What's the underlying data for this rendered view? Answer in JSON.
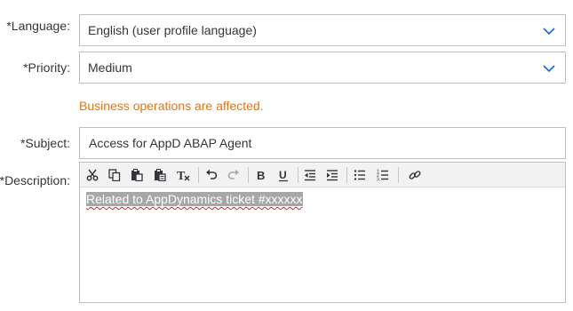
{
  "form": {
    "language_label": "*Language:",
    "language_value": "English (user profile language)",
    "priority_label": "*Priority:",
    "priority_value": "Medium",
    "priority_hint": "Business operations are affected.",
    "subject_label": "*Subject:",
    "subject_value": "Access for AppD ABAP Agent",
    "description_label": "*Description:",
    "description_value": "Related to AppDynamics ticket #xxxxxx"
  },
  "toolbar": {
    "buttons": [
      "cut-icon",
      "copy-icon",
      "paste-icon",
      "paste-as-text-icon",
      "remove-format-icon",
      "undo-icon",
      "redo-icon",
      "bold-icon",
      "underline-icon",
      "outdent-icon",
      "indent-icon",
      "bulleted-list-icon",
      "numbered-list-icon",
      "link-icon"
    ]
  },
  "colors": {
    "border": "#bfbfbf",
    "warning": "#e9730c",
    "text": "#32363a",
    "toolbar_bg": "#f2f2f2",
    "selection_bg": "#a7a7a7"
  }
}
